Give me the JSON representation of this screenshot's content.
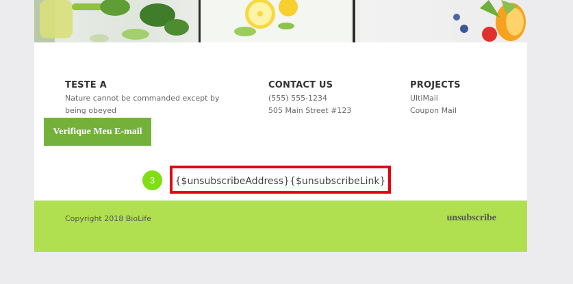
{
  "footer": {
    "col1": {
      "title": "TESTE A",
      "lines": [
        "Nature cannot be commanded except by",
        "being obeyed"
      ]
    },
    "col2": {
      "title": "CONTACT US",
      "lines": [
        "(555) 555-1234",
        "505 Main Street #123"
      ]
    },
    "col3": {
      "title": "PROJECTS",
      "lines": [
        "UltiMail",
        "Coupon Mail"
      ]
    }
  },
  "verify_button": {
    "label": "Verifique Meu E-mail"
  },
  "step_badge": {
    "number": "3"
  },
  "merge_tags": "{$unsubscribeAddress}{$unsubscribeLink}",
  "copyright": "Copyright 2018 BioLife",
  "unsubscribe_label": "unsubscribe",
  "colors": {
    "accent_green": "#74b13a",
    "bar_green": "#b0df50",
    "highlight_red": "#e8000b",
    "badge_green": "#7ee010"
  }
}
